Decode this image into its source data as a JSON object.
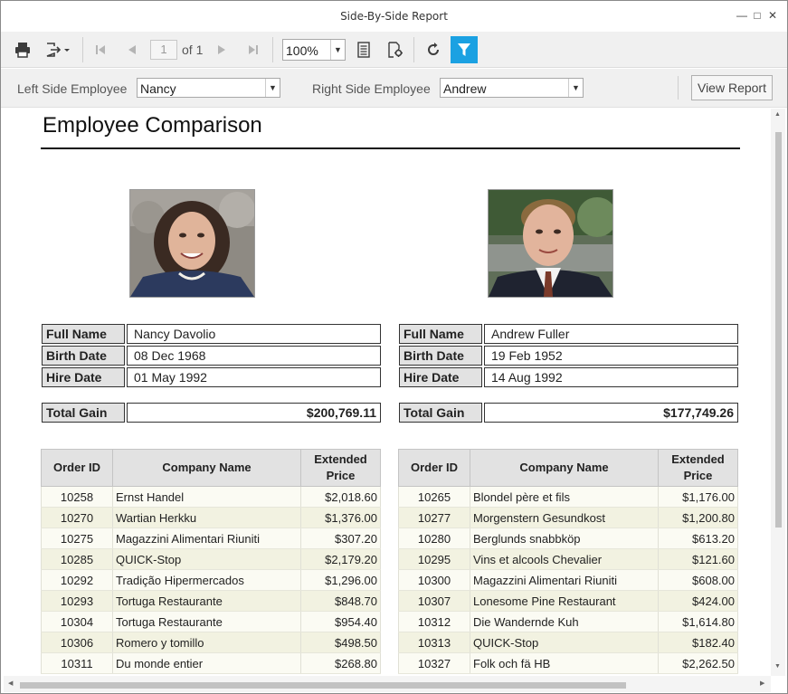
{
  "window": {
    "title": "Side-By-Side Report"
  },
  "toolbar": {
    "page_current": "1",
    "page_of": "of 1",
    "zoom": "100%"
  },
  "params": {
    "left_label": "Left Side Employee",
    "left_value": "Nancy",
    "right_label": "Right Side Employee",
    "right_value": "Andrew",
    "view_button": "View Report"
  },
  "report": {
    "title": "Employee Comparison",
    "labels": {
      "full_name": "Full Name",
      "birth_date": "Birth Date",
      "hire_date": "Hire Date",
      "total_gain": "Total Gain"
    },
    "columns": {
      "order_id": "Order ID",
      "company": "Company Name",
      "price": "Extended Price"
    },
    "left": {
      "full_name": "Nancy  Davolio",
      "birth_date": "08 Dec 1968",
      "hire_date": "01 May 1992",
      "total_gain": "$200,769.11",
      "orders": [
        [
          "10258",
          "Ernst Handel",
          "$2,018.60"
        ],
        [
          "10270",
          "Wartian Herkku",
          "$1,376.00"
        ],
        [
          "10275",
          "Magazzini Alimentari Riuniti",
          "$307.20"
        ],
        [
          "10285",
          "QUICK-Stop",
          "$2,179.20"
        ],
        [
          "10292",
          "Tradição Hipermercados",
          "$1,296.00"
        ],
        [
          "10293",
          "Tortuga Restaurante",
          "$848.70"
        ],
        [
          "10304",
          "Tortuga Restaurante",
          "$954.40"
        ],
        [
          "10306",
          "Romero y tomillo",
          "$498.50"
        ],
        [
          "10311",
          "Du monde entier",
          "$268.80"
        ]
      ]
    },
    "right": {
      "full_name": "Andrew  Fuller",
      "birth_date": "19 Feb 1952",
      "hire_date": "14 Aug 1992",
      "total_gain": "$177,749.26",
      "orders": [
        [
          "10265",
          "Blondel père et fils",
          "$1,176.00"
        ],
        [
          "10277",
          "Morgenstern Gesundkost",
          "$1,200.80"
        ],
        [
          "10280",
          "Berglunds snabbköp",
          "$613.20"
        ],
        [
          "10295",
          "Vins et alcools Chevalier",
          "$121.60"
        ],
        [
          "10300",
          "Magazzini Alimentari Riuniti",
          "$608.00"
        ],
        [
          "10307",
          "Lonesome Pine Restaurant",
          "$424.00"
        ],
        [
          "10312",
          "Die Wandernde Kuh",
          "$1,614.80"
        ],
        [
          "10313",
          "QUICK-Stop",
          "$182.40"
        ],
        [
          "10327",
          "Folk och fä HB",
          "$2,262.50"
        ]
      ]
    }
  },
  "colors": {
    "accent": "#1ba1e2",
    "header_bg": "#e2e2e2",
    "row_odd": "#fbfbf3",
    "row_even": "#f2f2e1"
  }
}
